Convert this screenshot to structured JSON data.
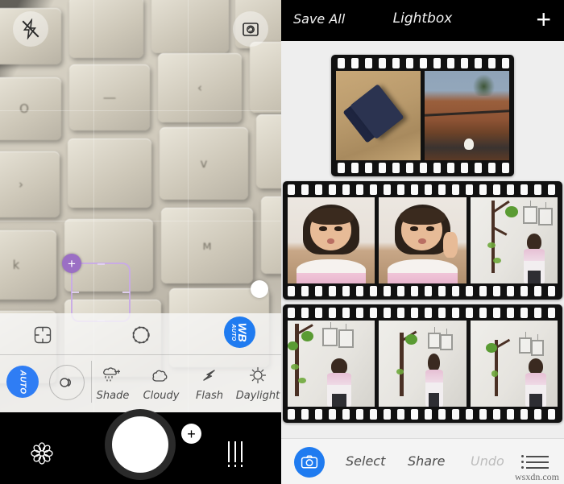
{
  "camera": {
    "top_controls": [
      {
        "name": "flash-off",
        "icon": "flash-off-icon",
        "label": "Flash Off"
      },
      {
        "name": "camera-switch",
        "icon": "camera-switch-icon",
        "label": "Switch Camera"
      }
    ],
    "focus_reticle": {
      "label": "Focus and exposure box",
      "handle": "+",
      "color": "#9b6fc4"
    },
    "exposure_slider_dot": {
      "label": "Exposure slider handle"
    },
    "tool_row": [
      {
        "name": "crop-tool",
        "icon": "crop-icon",
        "label": "Crop"
      },
      {
        "name": "filter-tool",
        "icon": "filter-circle-icon",
        "label": "Filter"
      },
      {
        "name": "white-balance-button",
        "icon": "wb-icon",
        "label": "WB",
        "sub_label": "AUTO",
        "color": "#1f7bf0",
        "active": true
      }
    ],
    "wb_modes": {
      "auto": {
        "label": "AUTO",
        "active": true,
        "color": "#2f7df4"
      },
      "tungsten": {
        "label": "Tungsten",
        "icon": "tungsten-bulb-icon"
      },
      "items": [
        {
          "label": "Shade",
          "icon": "shade-icon"
        },
        {
          "label": "Cloudy",
          "icon": "cloud-icon"
        },
        {
          "label": "Flash",
          "icon": "flash-bolt-icon"
        },
        {
          "label": "Daylight",
          "icon": "sun-icon"
        }
      ]
    },
    "shutter_bar": [
      {
        "name": "macro-flower-button",
        "icon": "flower-icon",
        "label": "Macro"
      },
      {
        "name": "shutter-button",
        "icon": "shutter-icon",
        "label": "Shutter"
      },
      {
        "name": "add-button",
        "icon": "plus-icon",
        "label": "+"
      },
      {
        "name": "settings-bars-button",
        "icon": "sliders-icon",
        "label": "Settings"
      }
    ]
  },
  "lightbox": {
    "header": {
      "save_all": "Save All",
      "title": "Lightbox",
      "add": "+"
    },
    "strips": [
      {
        "name": "film-strip-1",
        "frames": [
          {
            "alt": "SD memory card on wooden table",
            "art": "sdcard"
          },
          {
            "alt": "Tiled rooftops with palm trees and a white bird",
            "art": "roof"
          }
        ]
      },
      {
        "name": "film-strip-2",
        "frames": [
          {
            "alt": "Girl making a face at the camera",
            "art": "girl-pout"
          },
          {
            "alt": "Girl smiling with peace sign",
            "art": "girl-peace"
          },
          {
            "alt": "Girl standing by tree wall decal",
            "art": "wall-kid"
          }
        ]
      },
      {
        "name": "film-strip-3",
        "frames": [
          {
            "alt": "Girl beside tree wall decal, close view",
            "art": "wall-kid"
          },
          {
            "alt": "Girl standing in front of tree wall decal",
            "art": "wall-kid"
          },
          {
            "alt": "Girl touching tree wall decal",
            "art": "wall-kid"
          }
        ]
      }
    ],
    "footer": {
      "camera_button": "camera-icon",
      "select": "Select",
      "share": "Share",
      "undo": "Undo",
      "undo_disabled": true,
      "menu": "list-menu-icon"
    },
    "watermark": "wsxdn.com"
  }
}
